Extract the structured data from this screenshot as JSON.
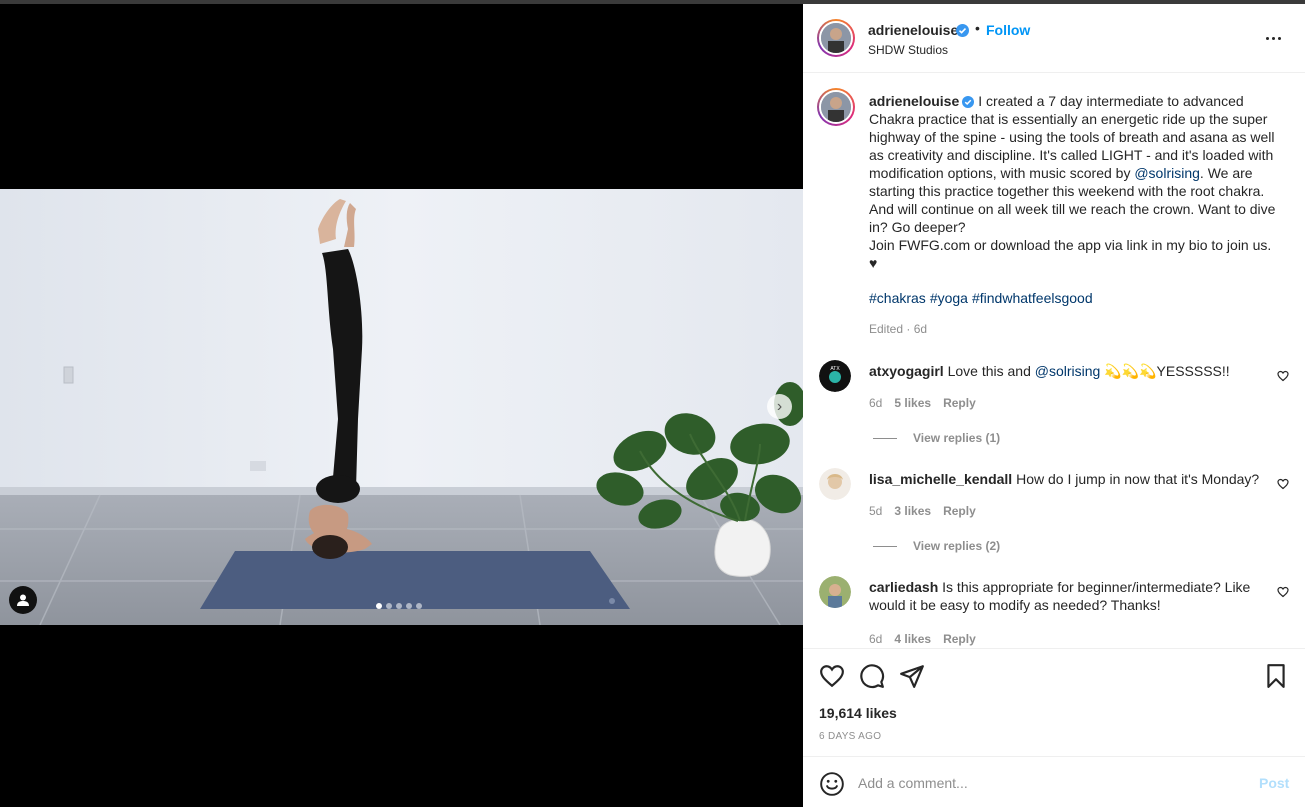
{
  "post": {
    "username": "adrienelouise",
    "follow_label": "Follow",
    "bullet": "•",
    "location": "SHDW Studios"
  },
  "caption": {
    "username": "adrienelouise",
    "text_before_mention": "I created a 7 day intermediate to advanced Chakra practice that is essentially an energetic ride up the super highway of the spine - using the tools of breath and asana as well as creativity and discipline. It's called LIGHT - and it's loaded with modification options, with music scored by ",
    "mention": "@solrising",
    "text_after_mention": ". We are starting this practice together this weekend with the root chakra. And will continue on all week till we reach the crown. Want to dive in? Go deeper?",
    "line2": "Join FWFG.com or download the app via link in my bio to join us.",
    "heart": "♥",
    "hashtags": [
      "#chakras",
      "#yoga",
      "#findwhatfeelsgood"
    ],
    "edited": "Edited · 6d"
  },
  "comments": [
    {
      "username": "atxyogagirl",
      "text_before": "Love this and ",
      "mention": "@solrising",
      "text_after": " 💫💫💫YESSSSS!!",
      "time": "6d",
      "likes": "5 likes",
      "reply": "Reply",
      "view_replies": "View replies (1)"
    },
    {
      "username": "lisa_michelle_kendall",
      "text_before": "How do I jump in now that it's Monday?",
      "mention": "",
      "text_after": "",
      "time": "5d",
      "likes": "3 likes",
      "reply": "Reply",
      "view_replies": "View replies (2)"
    },
    {
      "username": "carliedash",
      "text_before": "Is this appropriate for beginner/intermediate? Like would it be easy to modify as needed? Thanks!",
      "mention": "",
      "text_after": "",
      "time": "6d",
      "likes": "4 likes",
      "reply": "Reply"
    }
  ],
  "stats": {
    "likes": "19,614 likes",
    "time_ago": "6 DAYS AGO"
  },
  "composer": {
    "placeholder": "Add a comment...",
    "post_label": "Post"
  },
  "colors": {
    "link": "#0095f6",
    "mention": "#00376b",
    "muted": "#8e8e8e",
    "verified": "#3897f0"
  },
  "icons": [
    "verified-badge-icon",
    "more-options-icon",
    "heart-icon",
    "comment-icon",
    "share-icon",
    "bookmark-icon",
    "emoji-icon",
    "next-arrow-icon",
    "user-tag-icon"
  ],
  "carousel": {
    "count": 5,
    "active": 0
  }
}
